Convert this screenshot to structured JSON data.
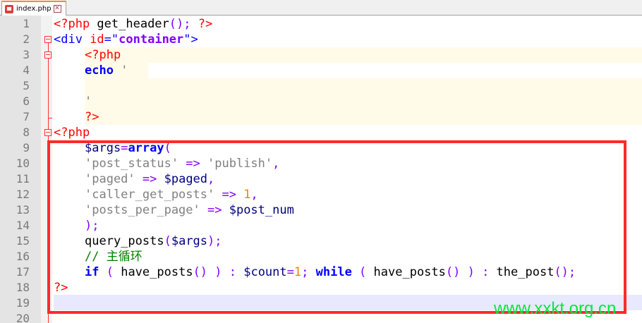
{
  "tab": {
    "label": "index.php",
    "close_glyph": "✕"
  },
  "lines": [
    {
      "n": "1"
    },
    {
      "n": "2"
    },
    {
      "n": "3"
    },
    {
      "n": "4"
    },
    {
      "n": "5"
    },
    {
      "n": "6"
    },
    {
      "n": "7"
    },
    {
      "n": "8"
    },
    {
      "n": "9"
    },
    {
      "n": "10"
    },
    {
      "n": "11"
    },
    {
      "n": "12"
    },
    {
      "n": "13"
    },
    {
      "n": "14"
    },
    {
      "n": "15"
    },
    {
      "n": "16"
    },
    {
      "n": "17"
    },
    {
      "n": "18"
    },
    {
      "n": "19"
    },
    {
      "n": "20"
    }
  ],
  "code": {
    "l1": [
      "<?php",
      " get_header",
      "(); ",
      "?>"
    ],
    "l2": [
      "<div ",
      "id",
      "=\"",
      "container",
      "\">"
    ],
    "l3": [
      "<?php"
    ],
    "l4": [
      "echo",
      " '"
    ],
    "l6": [
      "'"
    ],
    "l7": [
      "?>"
    ],
    "l8": [
      "<?php"
    ],
    "l9": [
      "$args",
      "=",
      "array",
      "("
    ],
    "l10": [
      "'post_status'",
      " => ",
      "'publish'",
      ","
    ],
    "l11": [
      "'paged'",
      " => ",
      "$paged",
      ","
    ],
    "l12": [
      "'caller_get_posts'",
      " => ",
      "1",
      ","
    ],
    "l13": [
      "'posts_per_page'",
      " => ",
      "$post_num"
    ],
    "l14": [
      ");"
    ],
    "l15": [
      "query_posts",
      "(",
      "$args",
      ");"
    ],
    "l16": [
      "// 主循环"
    ],
    "l17": [
      "if",
      " ( ",
      "have_posts",
      "() ) : ",
      "$count",
      "=",
      "1",
      "; ",
      "while",
      " ( ",
      "have_posts",
      "() ) : ",
      "the_post",
      "();"
    ],
    "l18": [
      "?>"
    ]
  },
  "watermark": "www.xxkt.org.cn",
  "colors": {
    "php_tag": "#ff0000",
    "keyword": "#0000ff",
    "string": "#808080",
    "operator": "#8000ff",
    "number": "#ff8000",
    "comment": "#008000",
    "selection_box": "#ff2a2a",
    "watermark": "#00ea3e"
  }
}
